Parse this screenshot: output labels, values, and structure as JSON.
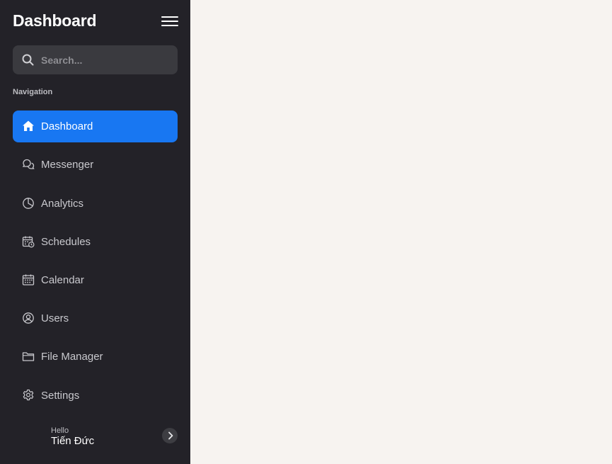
{
  "sidebar": {
    "title": "Dashboard",
    "search": {
      "placeholder": "Search..."
    },
    "nav_heading": "Navigation",
    "items": [
      {
        "label": "Dashboard",
        "icon": "home-icon"
      },
      {
        "label": "Messenger",
        "icon": "chat-icon"
      },
      {
        "label": "Analytics",
        "icon": "pie-chart-icon"
      },
      {
        "label": "Schedules",
        "icon": "schedule-icon"
      },
      {
        "label": "Calendar",
        "icon": "calendar-icon"
      },
      {
        "label": "Users",
        "icon": "user-icon"
      },
      {
        "label": "File Manager",
        "icon": "folder-icon"
      },
      {
        "label": "Settings",
        "icon": "gear-icon"
      }
    ],
    "user": {
      "greeting": "Hello",
      "name": "Tiến Đức"
    }
  },
  "colors": {
    "sidebar_bg": "#232228",
    "accent": "#1877f2",
    "main_bg": "#f7f3f0"
  }
}
